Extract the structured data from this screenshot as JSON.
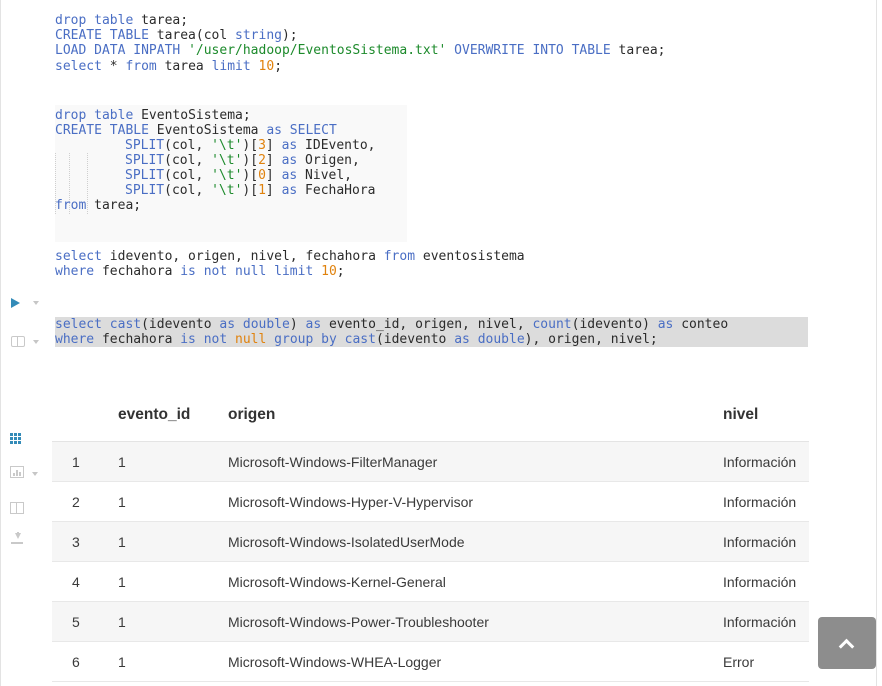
{
  "editor": {
    "lines": {
      "l1": [
        {
          "t": "drop table",
          "c": "kw"
        },
        {
          "t": " tarea;",
          "c": "tx"
        }
      ],
      "l2": [
        {
          "t": "CREATE TABLE",
          "c": "kw"
        },
        {
          "t": " tarea(col ",
          "c": "tx"
        },
        {
          "t": "string",
          "c": "kw"
        },
        {
          "t": ");",
          "c": "tx"
        }
      ],
      "l3": [
        {
          "t": "LOAD DATA INPATH",
          "c": "kw"
        },
        {
          "t": " ",
          "c": "tx"
        },
        {
          "t": "'/user/hadoop/EventosSistema.txt'",
          "c": "str"
        },
        {
          "t": " ",
          "c": "tx"
        },
        {
          "t": "OVERWRITE INTO TABLE",
          "c": "kw"
        },
        {
          "t": " tarea;",
          "c": "tx"
        }
      ],
      "l4": [
        {
          "t": "select",
          "c": "kw"
        },
        {
          "t": " * ",
          "c": "tx"
        },
        {
          "t": "from",
          "c": "kw"
        },
        {
          "t": " tarea ",
          "c": "tx"
        },
        {
          "t": "limit",
          "c": "kw"
        },
        {
          "t": " ",
          "c": "tx"
        },
        {
          "t": "10",
          "c": "num"
        },
        {
          "t": ";",
          "c": "tx"
        }
      ],
      "l6": [
        {
          "t": "drop table",
          "c": "kw"
        },
        {
          "t": " EventoSistema;",
          "c": "tx"
        }
      ],
      "l7": [
        {
          "t": "CREATE TABLE",
          "c": "kw"
        },
        {
          "t": " EventoSistema ",
          "c": "tx"
        },
        {
          "t": "as SELECT",
          "c": "kw"
        }
      ],
      "l8": [
        {
          "t": "SPLIT",
          "c": "kw"
        },
        {
          "t": "(col, ",
          "c": "tx"
        },
        {
          "t": "'\\t'",
          "c": "str"
        },
        {
          "t": ")[",
          "c": "tx"
        },
        {
          "t": "3",
          "c": "num"
        },
        {
          "t": "] ",
          "c": "tx"
        },
        {
          "t": "as",
          "c": "kw"
        },
        {
          "t": " IDEvento,",
          "c": "tx"
        }
      ],
      "l9": [
        {
          "t": "SPLIT",
          "c": "kw"
        },
        {
          "t": "(col, ",
          "c": "tx"
        },
        {
          "t": "'\\t'",
          "c": "str"
        },
        {
          "t": ")[",
          "c": "tx"
        },
        {
          "t": "2",
          "c": "num"
        },
        {
          "t": "] ",
          "c": "tx"
        },
        {
          "t": "as",
          "c": "kw"
        },
        {
          "t": " Origen,",
          "c": "tx"
        }
      ],
      "l10": [
        {
          "t": "SPLIT",
          "c": "kw"
        },
        {
          "t": "(col, ",
          "c": "tx"
        },
        {
          "t": "'\\t'",
          "c": "str"
        },
        {
          "t": ")[",
          "c": "tx"
        },
        {
          "t": "0",
          "c": "num"
        },
        {
          "t": "] ",
          "c": "tx"
        },
        {
          "t": "as",
          "c": "kw"
        },
        {
          "t": " Nivel,",
          "c": "tx"
        }
      ],
      "l11": [
        {
          "t": "SPLIT",
          "c": "kw"
        },
        {
          "t": "(col, ",
          "c": "tx"
        },
        {
          "t": "'\\t'",
          "c": "str"
        },
        {
          "t": ")[",
          "c": "tx"
        },
        {
          "t": "1",
          "c": "num"
        },
        {
          "t": "] ",
          "c": "tx"
        },
        {
          "t": "as",
          "c": "kw"
        },
        {
          "t": " FechaHora",
          "c": "tx"
        }
      ],
      "l12": [
        {
          "t": "from",
          "c": "kw"
        },
        {
          "t": " tarea;",
          "c": "tx"
        }
      ],
      "l14": [
        {
          "t": "select",
          "c": "kw"
        },
        {
          "t": " idevento, origen, nivel, fechahora ",
          "c": "tx"
        },
        {
          "t": "from",
          "c": "kw"
        },
        {
          "t": " eventosistema",
          "c": "tx"
        }
      ],
      "l15": [
        {
          "t": "where",
          "c": "kw"
        },
        {
          "t": " fechahora ",
          "c": "tx"
        },
        {
          "t": "is not null limit",
          "c": "kw"
        },
        {
          "t": " ",
          "c": "tx"
        },
        {
          "t": "10",
          "c": "num"
        },
        {
          "t": ";",
          "c": "tx"
        }
      ],
      "l17": [
        {
          "t": "select",
          "c": "kw"
        },
        {
          "t": " ",
          "c": "tx"
        },
        {
          "t": "cast",
          "c": "kw"
        },
        {
          "t": "(idevento ",
          "c": "tx"
        },
        {
          "t": "as double",
          "c": "kw"
        },
        {
          "t": ") ",
          "c": "tx"
        },
        {
          "t": "as",
          "c": "kw"
        },
        {
          "t": " evento_id, origen, nivel, ",
          "c": "tx"
        },
        {
          "t": "count",
          "c": "kw"
        },
        {
          "t": "(idevento) ",
          "c": "tx"
        },
        {
          "t": "as",
          "c": "kw"
        },
        {
          "t": " conteo",
          "c": "tx"
        }
      ],
      "l18": [
        {
          "t": "where",
          "c": "kw"
        },
        {
          "t": " fechahora ",
          "c": "tx"
        },
        {
          "t": "is not",
          "c": "kw"
        },
        {
          "t": " ",
          "c": "tx"
        },
        {
          "t": "null",
          "c": "num"
        },
        {
          "t": " ",
          "c": "tx"
        },
        {
          "t": "group by",
          "c": "kw"
        },
        {
          "t": " ",
          "c": "tx"
        },
        {
          "t": "cast",
          "c": "kw"
        },
        {
          "t": "(idevento ",
          "c": "tx"
        },
        {
          "t": "as double",
          "c": "kw"
        },
        {
          "t": "), origen, nivel;",
          "c": "tx"
        }
      ]
    }
  },
  "results": {
    "columns": [
      "evento_id",
      "origen",
      "nivel"
    ],
    "rows": [
      {
        "n": "1",
        "evento_id": "1",
        "origen": "Microsoft-Windows-FilterManager",
        "nivel": "Información"
      },
      {
        "n": "2",
        "evento_id": "1",
        "origen": "Microsoft-Windows-Hyper-V-Hypervisor",
        "nivel": "Información"
      },
      {
        "n": "3",
        "evento_id": "1",
        "origen": "Microsoft-Windows-IsolatedUserMode",
        "nivel": "Información"
      },
      {
        "n": "4",
        "evento_id": "1",
        "origen": "Microsoft-Windows-Kernel-General",
        "nivel": "Información"
      },
      {
        "n": "5",
        "evento_id": "1",
        "origen": "Microsoft-Windows-Power-Troubleshooter",
        "nivel": "Información"
      },
      {
        "n": "6",
        "evento_id": "1",
        "origen": "Microsoft-Windows-WHEA-Logger",
        "nivel": "Error"
      }
    ]
  },
  "icons": {
    "play": "play-icon",
    "snippet": "book-icon",
    "grid": "grid-icon",
    "chart": "bar-chart-icon",
    "columns": "columns-icon",
    "download": "download-icon",
    "scroll_top": "chevron-up-icon"
  },
  "colors": {
    "keyword": "#4a6ec4",
    "string": "#1c8a2b",
    "number": "#e0820d",
    "accent": "#338bb8",
    "selection": "#dcdcdc"
  }
}
